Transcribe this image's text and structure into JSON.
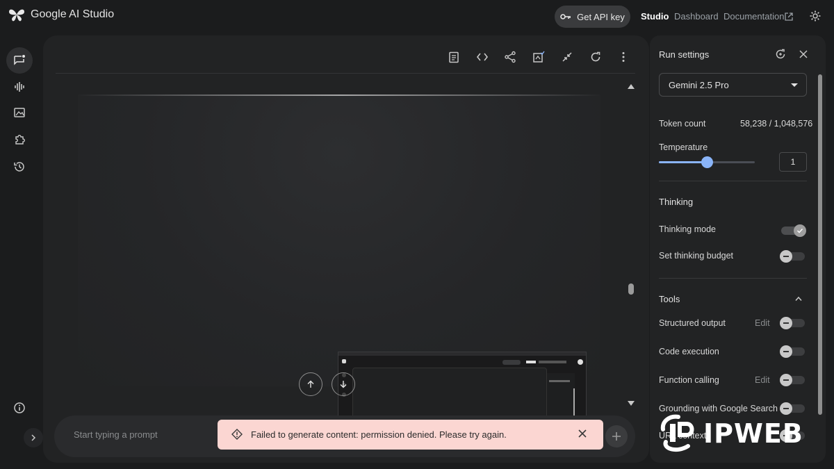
{
  "app": {
    "title": "Google AI Studio"
  },
  "topbar": {
    "api_key_label": "Get API key",
    "nav": [
      {
        "label": "Studio",
        "active": true
      },
      {
        "label": "Dashboard",
        "active": false
      },
      {
        "label": "Documentation",
        "active": false
      }
    ]
  },
  "rail": {
    "icons": [
      "new-chat-icon",
      "stream-icon",
      "media-icon",
      "build-icon",
      "history-icon",
      "info-icon"
    ]
  },
  "toolbar": {
    "icons": [
      "clipboard-icon",
      "code-icon",
      "share-icon",
      "compare-icon",
      "fullscreen-icon",
      "refresh-icon",
      "more-icon"
    ]
  },
  "prompt": {
    "placeholder": "Start typing a prompt"
  },
  "toast": {
    "message": "Failed to generate content: permission denied. Please try again."
  },
  "run_settings": {
    "title": "Run settings",
    "model": "Gemini 2.5 Pro",
    "token_count_label": "Token count",
    "token_count_value": "58,238 / 1,048,576",
    "temperature_label": "Temperature",
    "temperature_value": "1",
    "temperature_fraction": 0.5,
    "thinking": {
      "title": "Thinking",
      "thinking_mode_label": "Thinking mode",
      "thinking_mode_on": true,
      "budget_label": "Set thinking budget",
      "budget_on": false
    },
    "tools": {
      "title": "Tools",
      "items": [
        {
          "label": "Structured output",
          "edit": "Edit",
          "on": false
        },
        {
          "label": "Code execution",
          "edit": "",
          "on": false
        },
        {
          "label": "Function calling",
          "edit": "Edit",
          "on": false
        },
        {
          "label": "Grounding with Google Search",
          "edit": "",
          "on": false
        },
        {
          "label": "URL context",
          "edit": "",
          "on": false
        }
      ]
    }
  },
  "watermark": {
    "text": "IPWEB"
  },
  "colors": {
    "accent": "#8ab4f8",
    "toast_bg": "#fbd6d2",
    "background": "#1b1c1d",
    "panel": "#222324"
  }
}
